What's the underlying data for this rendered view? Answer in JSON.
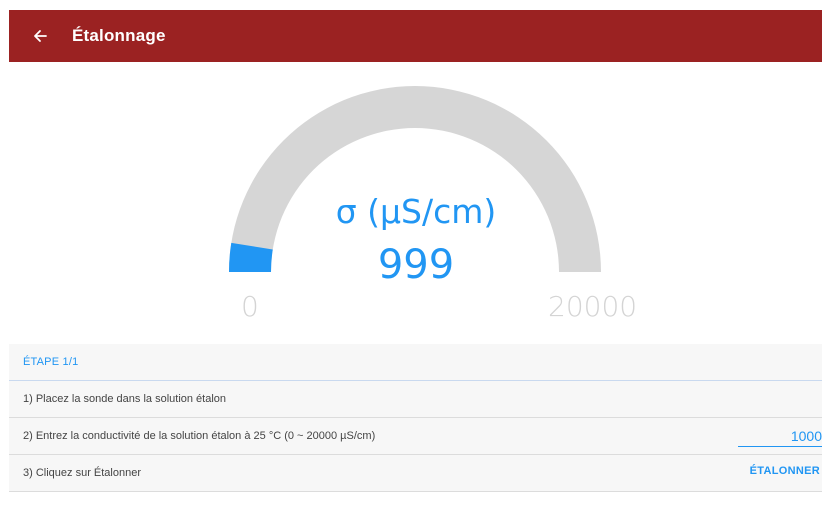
{
  "appbar": {
    "title": "Étalonnage",
    "back_icon": "arrow-left-icon",
    "color": "#9b2222"
  },
  "gauge": {
    "unit_label": "σ (µS/cm)",
    "value_text": "999",
    "value": 999,
    "min_label": "0",
    "max_label": "20000",
    "min": 0,
    "max": 20000,
    "track_color": "#d6d6d6",
    "fill_color": "#2196f3"
  },
  "steps": {
    "header": "ÉTAPE 1/1",
    "step1": "1) Placez la sonde dans la solution étalon",
    "step2": "2) Entrez la conductivité de la solution étalon à 25 °C (0 ~ 20000 µS/cm)",
    "step2_input_value": "1000",
    "step3": "3) Cliquez sur Étalonner",
    "calibrate_label": "ÉTALONNER"
  }
}
